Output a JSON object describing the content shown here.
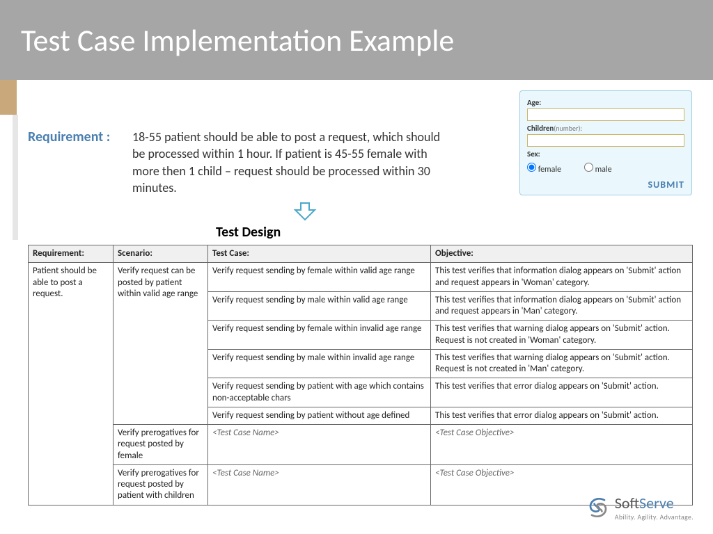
{
  "header": {
    "title": "Test Case Implementation Example"
  },
  "requirement": {
    "label": "Requirement :",
    "text": "18-55 patient should be able to post a request, which should be processed within 1 hour. If patient is 45-55 female with more then 1 child – request should be processed within 30 minutes."
  },
  "form": {
    "age_label": "Age:",
    "age_value": "",
    "children_label": "Children",
    "children_sub": "(number):",
    "children_value": "",
    "sex_label": "Sex:",
    "opt_female": "female",
    "opt_male": "male",
    "selected_sex": "female",
    "submit_label": "SUBMIT"
  },
  "design": {
    "title": "Test Design",
    "headers": {
      "req": "Requirement:",
      "scen": "Scenario:",
      "tc": "Test Case:",
      "obj": "Objective:"
    },
    "req_text": "Patient should be able to post a request.",
    "scenarios": [
      {
        "name": "Verify request can be posted by patient within valid age range",
        "cases": [
          {
            "tc": "Verify request sending by female within valid age range",
            "obj": "This test verifies that information dialog appears on 'Submit' action and request appears in 'Woman' category."
          },
          {
            "tc": "Verify request sending by male within valid age range",
            "obj": "This test verifies that information dialog appears on 'Submit' action and request appears in 'Man' category."
          },
          {
            "tc": "Verify request sending by female within invalid age range",
            "obj": "This test verifies that warning dialog appears on 'Submit' action. Request is not created in 'Woman' category."
          },
          {
            "tc": "Verify request sending by male within invalid age range",
            "obj": "This test verifies that warning dialog appears on 'Submit' action. Request is not created in 'Man' category."
          },
          {
            "tc": "Verify request sending by patient with age which contains non-acceptable chars",
            "obj": "This test verifies that error dialog appears on 'Submit' action."
          },
          {
            "tc": "Verify request sending by patient without age defined",
            "obj": "This test verifies that error dialog appears on 'Submit' action."
          }
        ]
      },
      {
        "name": "Verify prerogatives for request posted by female",
        "cases": [
          {
            "tc": "<Test Case Name>",
            "obj": "<Test Case Objective>"
          }
        ]
      },
      {
        "name": "Verify prerogatives for request posted by patient with children",
        "cases": [
          {
            "tc": "<Test Case Name>",
            "obj": "<Test Case Objective>"
          }
        ]
      }
    ]
  },
  "logo": {
    "name_a": "Soft",
    "name_b": "Serve",
    "tagline": "Ability. Agility. Advantage."
  }
}
